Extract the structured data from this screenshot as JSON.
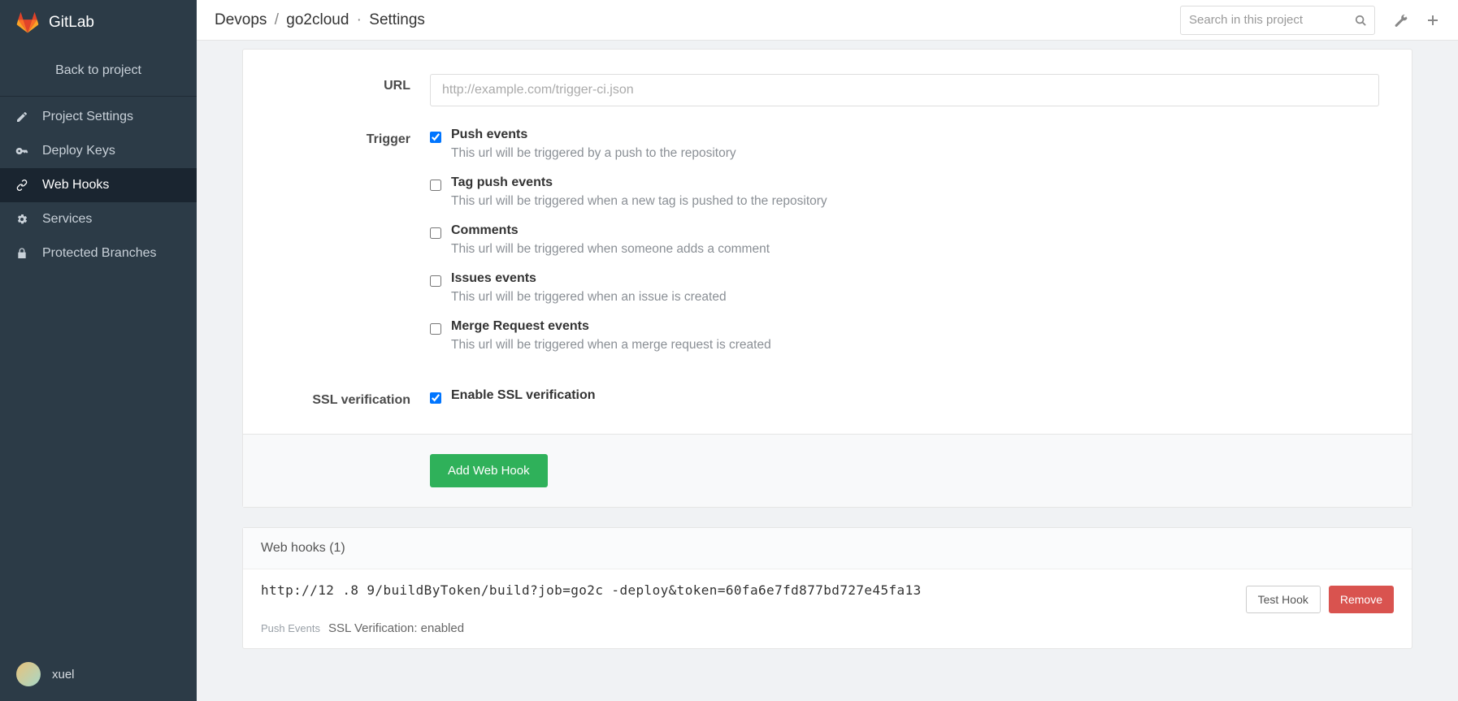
{
  "brand": "GitLab",
  "sidebar": {
    "back": "Back to project",
    "items": [
      {
        "icon": "edit",
        "label": "Project Settings"
      },
      {
        "icon": "key",
        "label": "Deploy Keys"
      },
      {
        "icon": "link",
        "label": "Web Hooks"
      },
      {
        "icon": "gear",
        "label": "Services"
      },
      {
        "icon": "lock",
        "label": "Protected Branches"
      }
    ],
    "active_index": 2,
    "user": "xuel"
  },
  "breadcrumb": {
    "group": "Devops",
    "project": "go2cloud",
    "page": "Settings"
  },
  "search_placeholder": "Search in this project",
  "form": {
    "url_label": "URL",
    "url_placeholder": "http://example.com/trigger-ci.json",
    "trigger_label": "Trigger",
    "triggers": [
      {
        "checked": true,
        "title": "Push events",
        "desc": "This url will be triggered by a push to the repository"
      },
      {
        "checked": false,
        "title": "Tag push events",
        "desc": "This url will be triggered when a new tag is pushed to the repository"
      },
      {
        "checked": false,
        "title": "Comments",
        "desc": "This url will be triggered when someone adds a comment"
      },
      {
        "checked": false,
        "title": "Issues events",
        "desc": "This url will be triggered when an issue is created"
      },
      {
        "checked": false,
        "title": "Merge Request events",
        "desc": "This url will be triggered when a merge request is created"
      }
    ],
    "ssl_label": "SSL verification",
    "ssl_title": "Enable SSL verification",
    "ssl_checked": true,
    "submit": "Add Web Hook"
  },
  "hooks": {
    "heading": "Web hooks (1)",
    "list": [
      {
        "url": "http://12          .8  9/buildByToken/build?job=go2c                -deploy&token=60fa6e7fd877bd727e45fa13",
        "tag": "Push Events",
        "ssl": "SSL Verification: enabled",
        "test": "Test Hook",
        "remove": "Remove"
      }
    ]
  }
}
